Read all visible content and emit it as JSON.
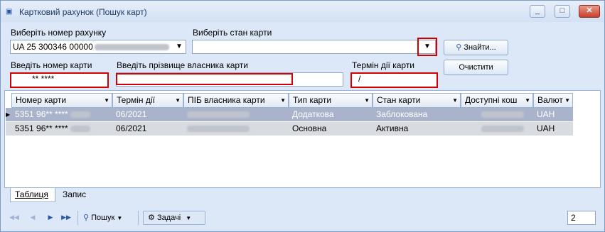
{
  "window": {
    "title": "Картковий рахунок (Пошук карт)",
    "minimize_glyph": "_",
    "maximize_glyph": "□",
    "close_glyph": "✕"
  },
  "filters": {
    "account_label": "Виберіть номер рахунку",
    "account_value": "UA 25 300346 00000",
    "card_state_label": "Виберіть стан карти",
    "card_state_value": "",
    "card_number_label": "Введіть номер карти",
    "card_number_value": "** ****",
    "owner_label": "Введіть прізвище власника карти",
    "owner_value": "",
    "expiry_label": "Термін дії карти",
    "expiry_value": "/"
  },
  "buttons": {
    "find": "Знайти...",
    "clear": "Очистити"
  },
  "grid": {
    "columns": [
      "Номер карти",
      "Термін дії",
      "ПІБ власника карти",
      "Тип карти",
      "Стан карти",
      "Доступні кош",
      "Валют"
    ],
    "rows": [
      {
        "number": "5351 96** ****",
        "expiry": "06/2021",
        "type": "Додаткова",
        "state": "Заблокована",
        "currency": "UAH",
        "selected": true
      },
      {
        "number": "5351 96** ****",
        "expiry": "06/2021",
        "type": "Основна",
        "state": "Активна",
        "currency": "UAH",
        "selected": false
      }
    ]
  },
  "tabs": [
    "Таблиця",
    "Запис"
  ],
  "toolbar": {
    "search": "Пошук",
    "tasks": "Задачі",
    "count": "2"
  },
  "colors": {
    "selected_row": "#a9b4cc",
    "row2": "#d8dbe0",
    "highlight": "#d40000"
  }
}
